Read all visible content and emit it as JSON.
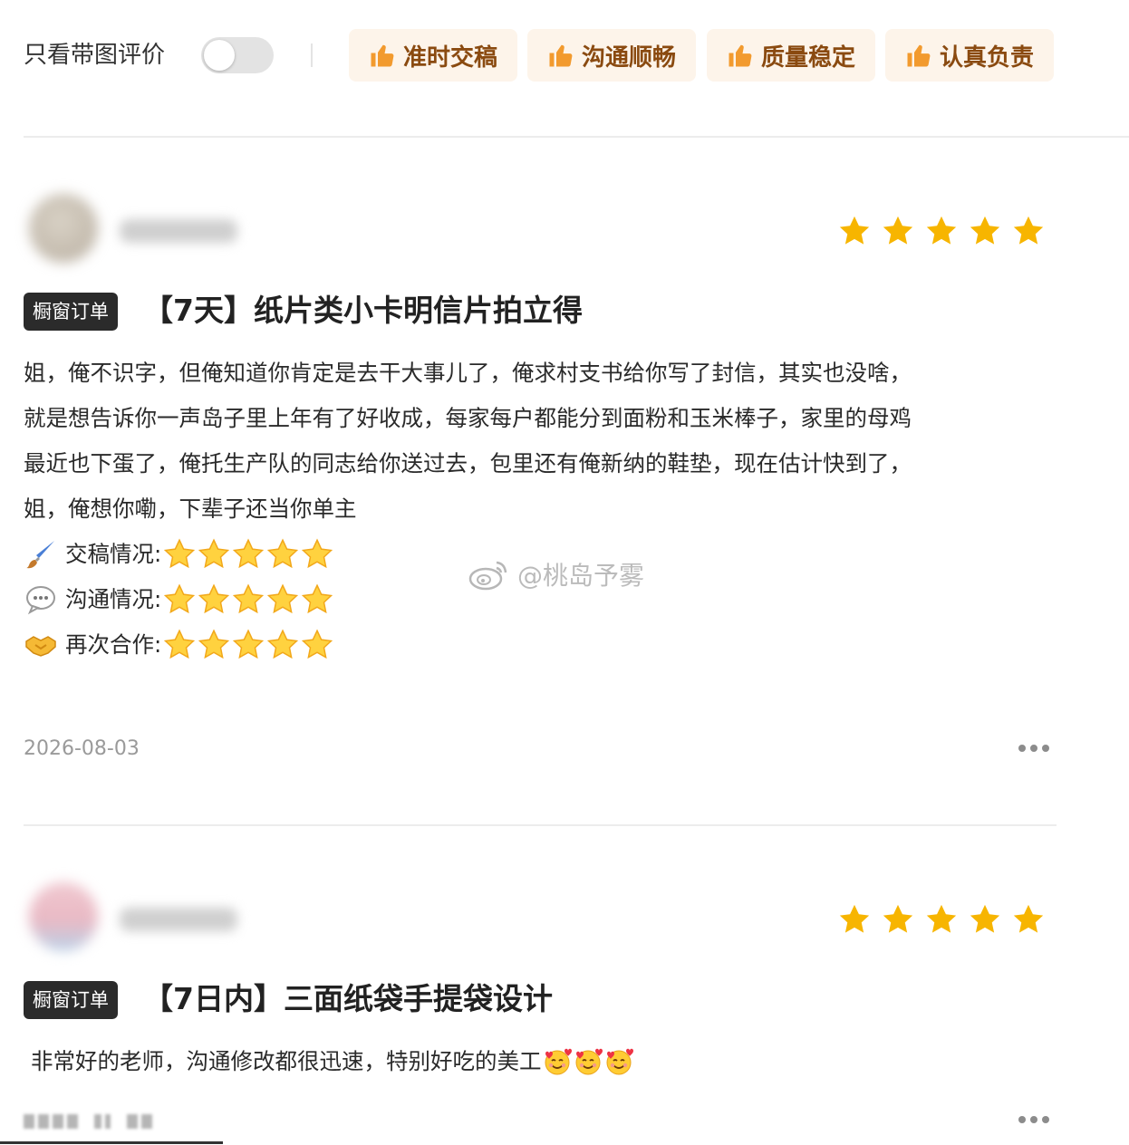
{
  "filter": {
    "toggle_label": "只看带图评价",
    "toggle_on": false,
    "tags": [
      {
        "label": "准时交稿",
        "icon": "thumbs-up-icon"
      },
      {
        "label": "沟通顺畅",
        "icon": "thumbs-up-icon"
      },
      {
        "label": "质量稳定",
        "icon": "thumbs-up-icon"
      },
      {
        "label": "认真负责",
        "icon": "thumbs-up-icon"
      }
    ]
  },
  "reviews": [
    {
      "rating": 5,
      "badge": "橱窗订单",
      "product_title": "【7天】纸片类小卡明信片拍立得",
      "body_lines": [
        " 姐，俺不识字，但俺知道你肯定是去干大事儿了，俺求村支书给你写了封信，其实也没啥，",
        "就是想告诉你一声岛子里上年有了好收成，每家每户都能分到面粉和玉米棒子，家里的母鸡",
        "最近也下蛋了，俺托生产队的同志给你送过去，包里还有俺新纳的鞋垫，现在估计快到了，",
        "姐，俺想你嘞，下辈子还当你单主"
      ],
      "sub_ratings": [
        {
          "icon": "paintbrush-icon",
          "label": "交稿情况:",
          "stars": 5
        },
        {
          "icon": "speech-bubble-icon",
          "label": "沟通情况:",
          "stars": 5
        },
        {
          "icon": "handshake-icon",
          "label": "再次合作:",
          "stars": 5
        }
      ],
      "date": "2026-08-03"
    },
    {
      "rating": 5,
      "badge": "橱窗订单",
      "product_title": "【7日内】三面纸袋手提袋设计",
      "body_text": "非常好的老师，沟通修改都很迅速，特别好吃的美工",
      "emoji": [
        "smiling-face-with-hearts-icon",
        "smiling-face-with-hearts-icon",
        "smiling-face-with-hearts-icon"
      ]
    }
  ],
  "watermark": {
    "text": "@桃岛予雾",
    "icon": "weibo-logo-icon"
  },
  "colors": {
    "star": "#f7b500",
    "chip_bg": "#fdf4ea",
    "chip_text": "#8a4a10",
    "badge_bg": "#2b2b2b"
  }
}
